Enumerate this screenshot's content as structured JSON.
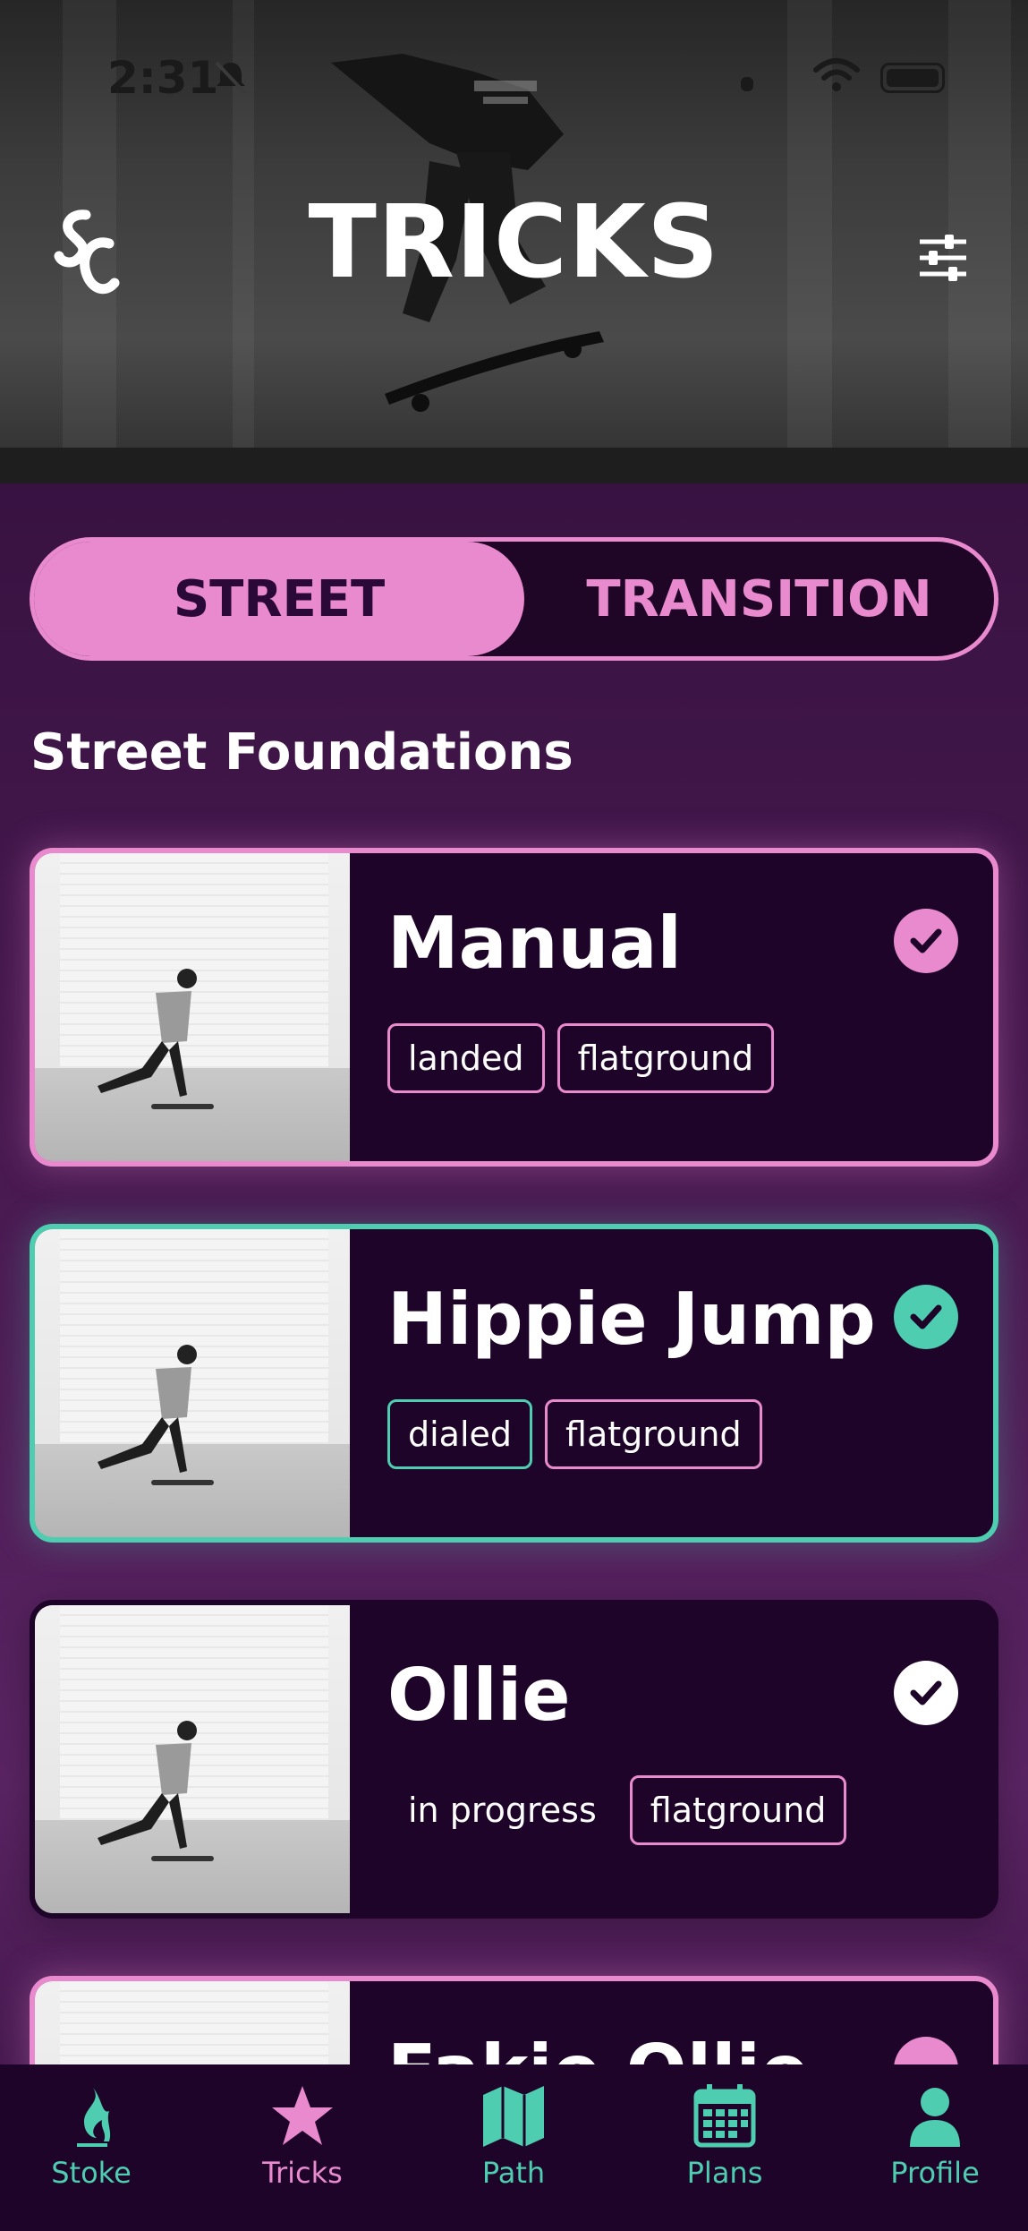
{
  "status_bar": {
    "time": "2:31"
  },
  "header": {
    "title": "TRICKS",
    "logo_icon": "sc-logo-icon",
    "filter_icon": "sliders-icon"
  },
  "segment": {
    "options": [
      "STREET",
      "TRANSITION"
    ],
    "selected": "STREET"
  },
  "section": {
    "title": "Street Foundations"
  },
  "tricks": [
    {
      "name": "Manual",
      "status": "landed",
      "category": "flatground",
      "accent": "#e98acf"
    },
    {
      "name": "Hippie Jump",
      "status": "dialed",
      "category": "flatground",
      "accent": "#4ecdb0"
    },
    {
      "name": "Ollie",
      "status": "in progress",
      "category": "flatground",
      "accent": "#ffffff"
    },
    {
      "name": "Fakie Ollie",
      "status": "",
      "category": "",
      "accent": "#e98acf"
    }
  ],
  "tab_bar": {
    "items": [
      {
        "label": "Stoke",
        "icon": "flame-icon"
      },
      {
        "label": "Tricks",
        "icon": "star-icon"
      },
      {
        "label": "Path",
        "icon": "map-icon"
      },
      {
        "label": "Plans",
        "icon": "calendar-icon"
      },
      {
        "label": "Profile",
        "icon": "person-icon"
      }
    ],
    "active": "Tricks"
  },
  "colors": {
    "pink": "#e98acf",
    "teal": "#4ecdb0",
    "card_bg": "#1e0428",
    "page_bg": "#3a1343"
  }
}
